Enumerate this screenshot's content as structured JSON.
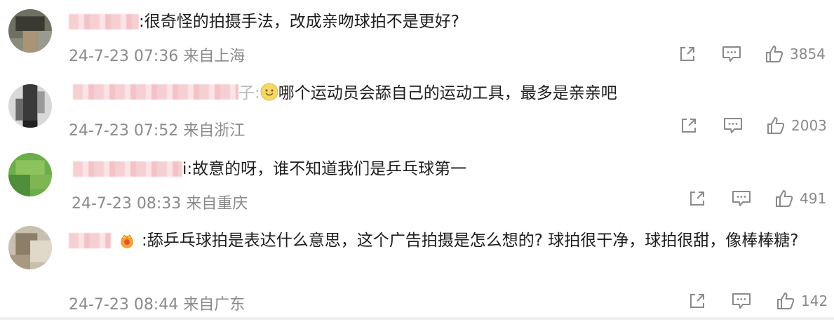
{
  "comments": [
    {
      "text": ":很奇怪的拍摄手法，改成亲吻球拍不是更好?",
      "time": "24-7-23 07:36",
      "location": "来自上海",
      "likes": "3854"
    },
    {
      "text": "哪个运动员会舔自己的运动工具，最多是亲亲吧",
      "prefix": "子:",
      "time": "24-7-23 07:52",
      "location": "来自浙江",
      "likes": "2003"
    },
    {
      "text": "i:故意的呀，谁不知道我们是乒乓球第一",
      "time": "24-7-23 08:33",
      "location": "来自重庆",
      "likes": "491"
    },
    {
      "text": ":舔乒乓球拍是表达什么意思，这个广告拍摄是怎么想的? 球拍很干净，球拍很甜，像棒棒糖?",
      "time": "24-7-23 08:44",
      "location": "来自广东",
      "likes": "142"
    }
  ],
  "colors": {
    "meta": "#8a8a8a",
    "text": "#1d1d1d",
    "name_blur": "#f6cfd3"
  },
  "icons": [
    "share-icon",
    "comment-icon",
    "like-icon",
    "smile-emoji-icon",
    "crown-badge-icon"
  ]
}
